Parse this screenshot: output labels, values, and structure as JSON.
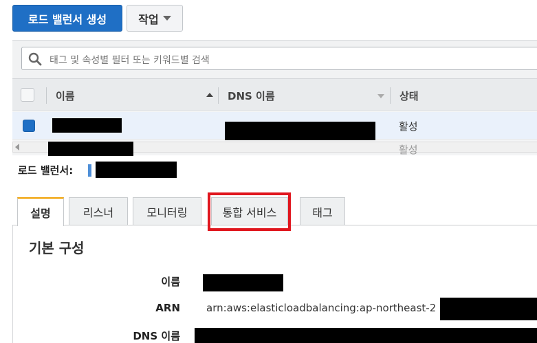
{
  "toolbar": {
    "create_label": "로드 밸런서 생성",
    "action_label": "작업"
  },
  "search": {
    "placeholder": "태그 및 속성별 필터 또는 키워드별 검색"
  },
  "table": {
    "columns": {
      "name": "이름",
      "dns": "DNS 이름",
      "status": "상태"
    },
    "rows": [
      {
        "status": "활성"
      },
      {
        "status": "활성"
      }
    ]
  },
  "detail": {
    "lb_label": "로드 밸런서:",
    "tabs": [
      "설명",
      "리스너",
      "모니터링",
      "통합 서비스",
      "태그"
    ],
    "section_title": "기본 구성",
    "fields": {
      "name_label": "이름",
      "arn_label": "ARN",
      "arn_value": "arn:aws:elasticloadbalancing:ap-northeast-2",
      "dns_label": "DNS 이름"
    }
  },
  "colors": {
    "primary": "#1f6fc5",
    "highlight": "#e0161e",
    "tab_active": "#f0a000"
  }
}
